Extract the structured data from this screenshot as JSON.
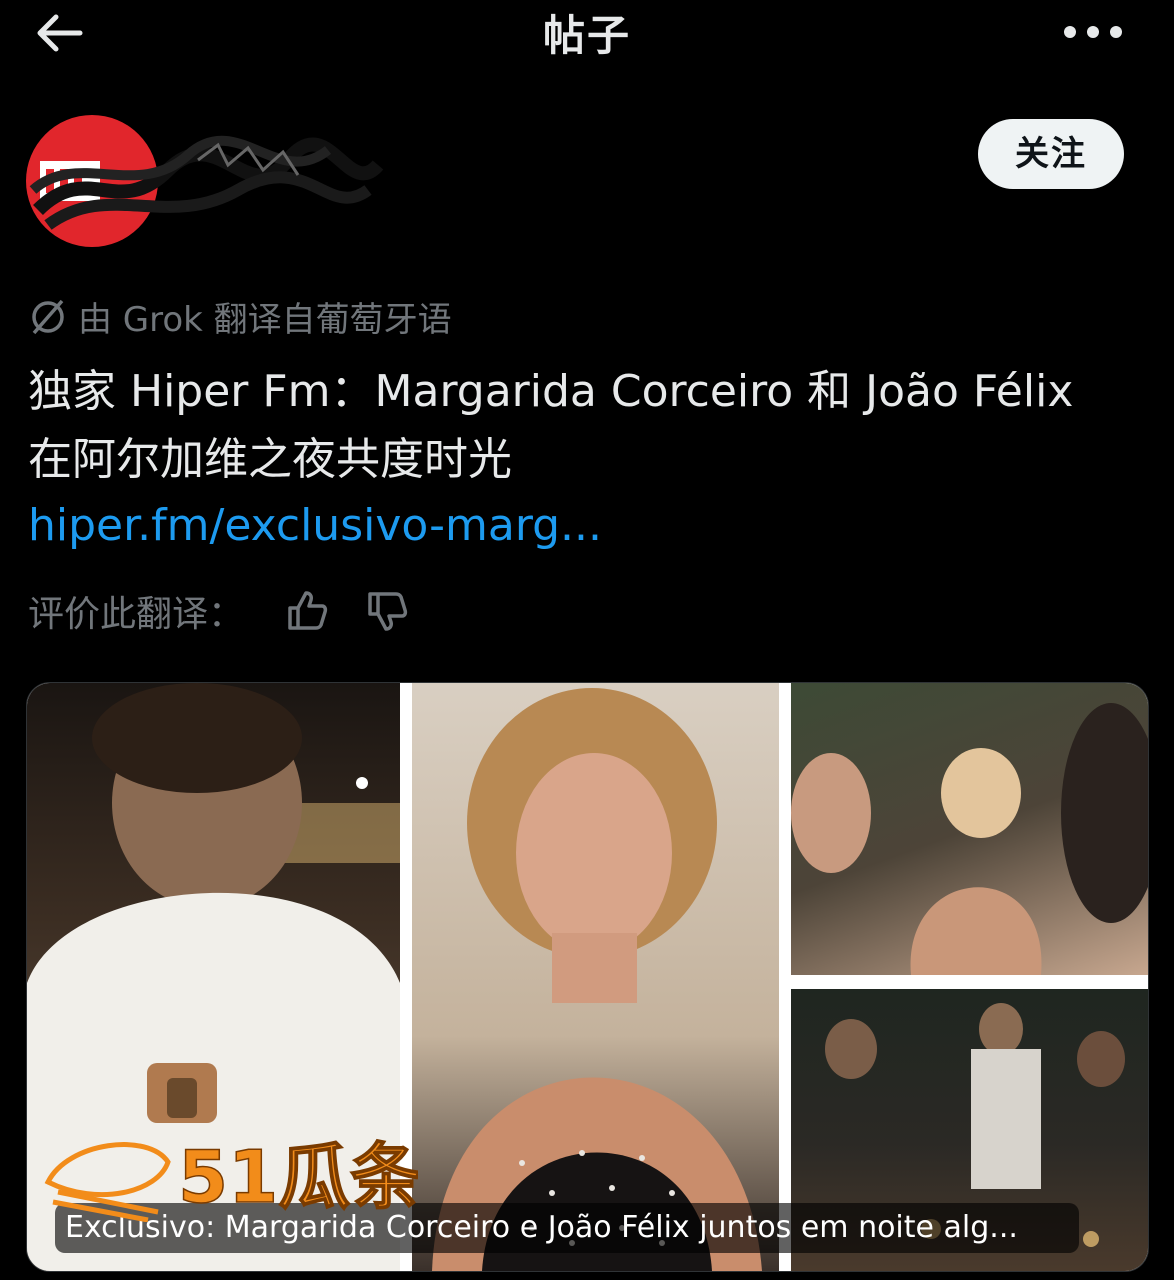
{
  "header": {
    "title": "帖子"
  },
  "account": {
    "follow_label": "关注"
  },
  "translation": {
    "note": "由 Grok 翻译自葡萄牙语"
  },
  "post": {
    "text": "独家 Hiper Fm：Margarida Corceiro 和 João Félix 在阿尔加维之夜共度时光",
    "link": "hiper.fm/exclusivo-marg..."
  },
  "rate": {
    "label": "评价此翻译："
  },
  "media": {
    "caption": "Exclusivo: Margarida Corceiro e João Félix juntos em noite alg..."
  },
  "watermark": {
    "text": "51瓜条"
  },
  "colors": {
    "accent_link": "#1d9bf0",
    "avatar_red": "#e1262c",
    "background": "#000000"
  },
  "icons": [
    "arrow-left-icon",
    "more-horizontal-icon",
    "translate-slash-icon",
    "thumbs-up-icon",
    "thumbs-down-icon"
  ]
}
